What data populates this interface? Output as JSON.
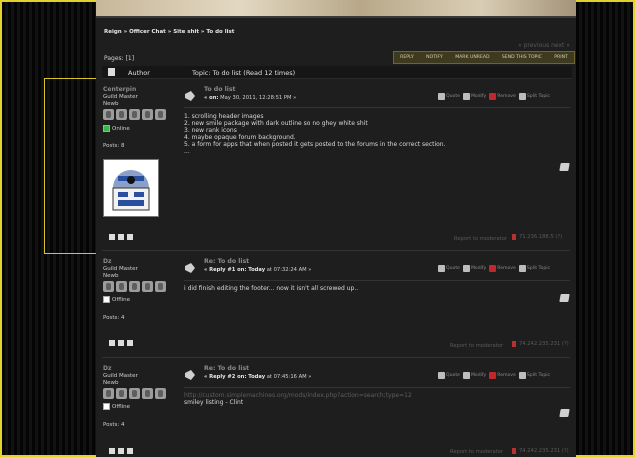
{
  "breadcrumb": "Reign » Officer Chat » Site shit » To do list",
  "prev_next": "« previous next »",
  "pages_label": "Pages: [1]",
  "buttons": [
    "REPLY",
    "NOTIFY",
    "MARK UNREAD",
    "SEND THIS TOPIC",
    "PRINT"
  ],
  "header": {
    "author": "Author",
    "topic": "Topic: To do list  (Read 12 times)"
  },
  "actions": {
    "quote": "Quote",
    "modify": "Modify",
    "remove": "Remove",
    "split": "Split Topic"
  },
  "report_label": "Report to moderator",
  "posts": [
    {
      "name": "Centerpin",
      "rank": "Guild Master",
      "group": "Newb",
      "status": "Online",
      "posts": "Posts: 8",
      "title": "To do list",
      "date_prefix": "« on:",
      "date": " May 30, 2011, 12:28:51 PM »",
      "lines": [
        "1. scrolling header images",
        "2. new smile package with dark outline so no ghey white shit",
        "3. new rank icons",
        "4. maybe opaque forum background.",
        "5. a form for apps that when posted it gets posted to the forums in the correct section.",
        "..."
      ],
      "ip": "71.236.188.5 (?)"
    },
    {
      "name": "Dz",
      "rank": "Guild Master",
      "group": "Newb",
      "status": "Offline",
      "posts": "Posts: 4",
      "title": "Re: To do list",
      "date_prefix": "« Reply #1 on: Today",
      "date": " at 07:32:24 AM »",
      "lines": [
        "i did finish editing the footer... now it isn't all screwed up.."
      ],
      "ip": "74.242.235.231 (?)"
    },
    {
      "name": "Dz",
      "rank": "Guild Master",
      "group": "Newb",
      "status": "Offline",
      "posts": "Posts: 4",
      "title": "Re: To do list",
      "date_prefix": "« Reply #2 on: Today",
      "date": " at 07:45:16 AM »",
      "link": "http://custom.simplemachines.org/mods/index.php?action=search;type=12",
      "lines": [
        "smiley listing - Clint"
      ],
      "ip": "74.242.235.231 (?)"
    }
  ]
}
